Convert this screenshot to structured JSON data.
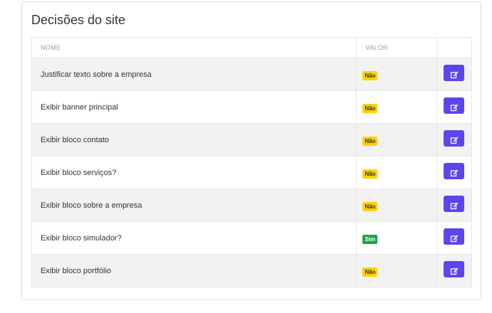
{
  "card": {
    "title": "Decisões do site"
  },
  "table": {
    "headers": {
      "name": "NOME",
      "value": "VALOR"
    },
    "rows": [
      {
        "name": "Justificar texto sobre a empresa",
        "value": "Não",
        "status": "nao"
      },
      {
        "name": "Exibir banner principal",
        "value": "Não",
        "status": "nao"
      },
      {
        "name": "Exibir bloco contato",
        "value": "Não",
        "status": "nao"
      },
      {
        "name": "Exibir bloco serviços?",
        "value": "Não",
        "status": "nao"
      },
      {
        "name": "Exibir bloco sobre a empresa",
        "value": "Não",
        "status": "nao"
      },
      {
        "name": "Exibir bloco simulador?",
        "value": "Sim",
        "status": "sim"
      },
      {
        "name": "Exibir bloco portfólio",
        "value": "Não",
        "status": "nao"
      }
    ]
  },
  "icons": {
    "edit": "edit-icon"
  },
  "colors": {
    "accent": "#5b45ef",
    "no_badge": "#fcd201",
    "yes_badge": "#1aa34a"
  }
}
